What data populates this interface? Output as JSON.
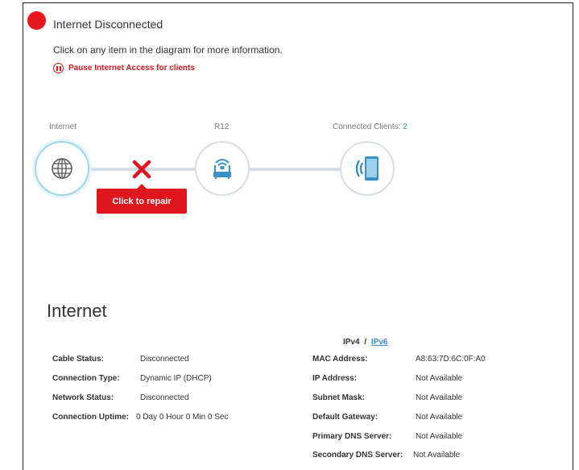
{
  "status": {
    "title": "Internet Disconnected",
    "instruction": "Click on any item in the diagram for more information.",
    "pause_link": "Pause Internet Access for clients",
    "color": "#e8161f"
  },
  "diagram": {
    "internet_label": "Internet",
    "router_label": "R12",
    "clients_label": "Connected Clients: ",
    "clients_count": "2",
    "repair_label": "Click to repair"
  },
  "internet_section": {
    "title": "Internet",
    "ipv4_label": "IPv4",
    "separator": "/",
    "ipv6_label": "IPv6",
    "left": [
      {
        "key": "Cable Status:",
        "value": "Disconnected"
      },
      {
        "key": "Connection Type:",
        "value": "Dynamic IP (DHCP)"
      },
      {
        "key": "Network Status:",
        "value": "Disconnected"
      },
      {
        "key": "Connection Uptime:",
        "value": "0 Day 0 Hour 0 Min 0 Sec"
      }
    ],
    "right": [
      {
        "key": "MAC Address:",
        "value": "A8:63:7D:6C:0F:A0"
      },
      {
        "key": "IP Address:",
        "value": "Not Available"
      },
      {
        "key": "Subnet Mask:",
        "value": "Not Available"
      },
      {
        "key": "Default Gateway:",
        "value": "Not Available"
      },
      {
        "key": "Primary DNS Server:",
        "value": "Not Available"
      },
      {
        "key": "Secondary DNS Server:",
        "value": "Not Available"
      }
    ]
  },
  "icons": {
    "status": "red-dot-icon",
    "pause": "pause-icon",
    "internet": "globe-icon",
    "router": "router-icon",
    "clients": "mobile-device-icon",
    "error": "error-x-icon"
  }
}
